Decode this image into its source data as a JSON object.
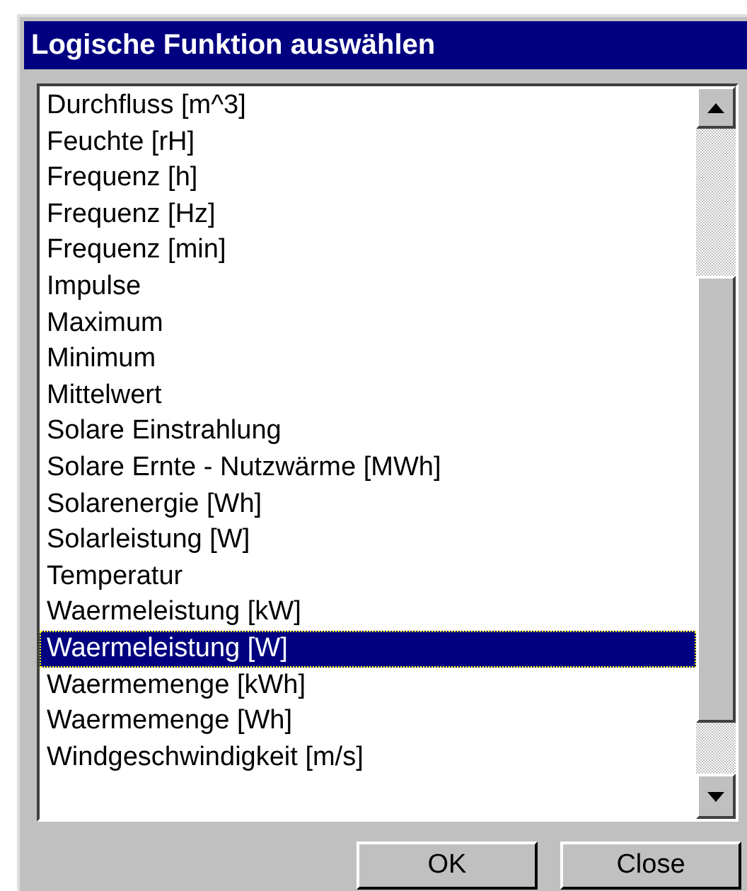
{
  "window": {
    "title": "Logische Funktion auswählen"
  },
  "list": {
    "items": [
      {
        "label": "Durchfluss [m^3]",
        "selected": false
      },
      {
        "label": "Feuchte [rH]",
        "selected": false
      },
      {
        "label": "Frequenz [h]",
        "selected": false
      },
      {
        "label": "Frequenz [Hz]",
        "selected": false
      },
      {
        "label": "Frequenz [min]",
        "selected": false
      },
      {
        "label": "Impulse",
        "selected": false
      },
      {
        "label": "Maximum",
        "selected": false
      },
      {
        "label": "Minimum",
        "selected": false
      },
      {
        "label": "Mittelwert",
        "selected": false
      },
      {
        "label": "Solare Einstrahlung",
        "selected": false
      },
      {
        "label": "Solare Ernte - Nutzwärme [MWh]",
        "selected": false
      },
      {
        "label": "Solarenergie [Wh]",
        "selected": false
      },
      {
        "label": "Solarleistung [W]",
        "selected": false
      },
      {
        "label": "Temperatur",
        "selected": false
      },
      {
        "label": "Waermeleistung [kW]",
        "selected": false
      },
      {
        "label": "Waermeleistung [W]",
        "selected": true
      },
      {
        "label": "Waermemenge [kWh]",
        "selected": false
      },
      {
        "label": "Waermemenge [Wh]",
        "selected": false
      },
      {
        "label": "Windgeschwindigkeit [m/s]",
        "selected": false
      }
    ]
  },
  "buttons": [
    {
      "label": "OK"
    },
    {
      "label": "Close"
    }
  ]
}
